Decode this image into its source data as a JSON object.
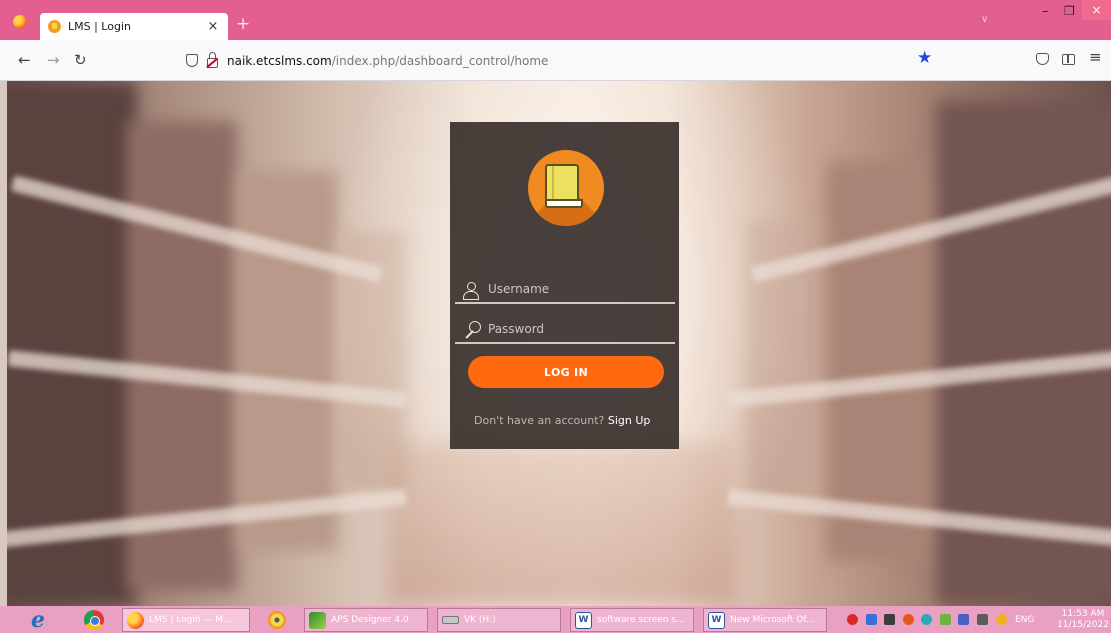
{
  "browser": {
    "tab_title": "LMS | Login",
    "tab_close": "×",
    "new_tab": "+",
    "url_host": "naik.etcslms.com",
    "url_path": "/index.php/dashboard_control/home",
    "window_minimize": "–",
    "window_maximize": "❐",
    "window_close": "×",
    "icons": [
      "firefox-icon",
      "back-icon",
      "forward-icon",
      "reload-icon",
      "shield-icon",
      "lock-icon",
      "star-icon",
      "pocket-icon",
      "sidebar-icon",
      "menu-icon"
    ]
  },
  "login": {
    "username_placeholder": "Username",
    "password_placeholder": "Password",
    "login_button": "LOG IN",
    "signup_prompt": "Don't have an account?",
    "signup_link": "Sign Up"
  },
  "taskbar": {
    "items": [
      {
        "label": "LMS | Login — M..."
      },
      {
        "label": "APS Designer 4.0"
      },
      {
        "label": "VK (H:)"
      },
      {
        "label": "software screen s..."
      },
      {
        "label": "New Microsoft Of..."
      }
    ],
    "language": "ENG",
    "time": "11:53 AM",
    "date": "11/15/2022"
  },
  "colors": {
    "title_bar": "#e35f8f",
    "accent_orange": "#ff6a10",
    "card_bg": "#3a322e",
    "taskbar": "#e9a0c2",
    "bookmark_star": "#1f4bd8"
  }
}
